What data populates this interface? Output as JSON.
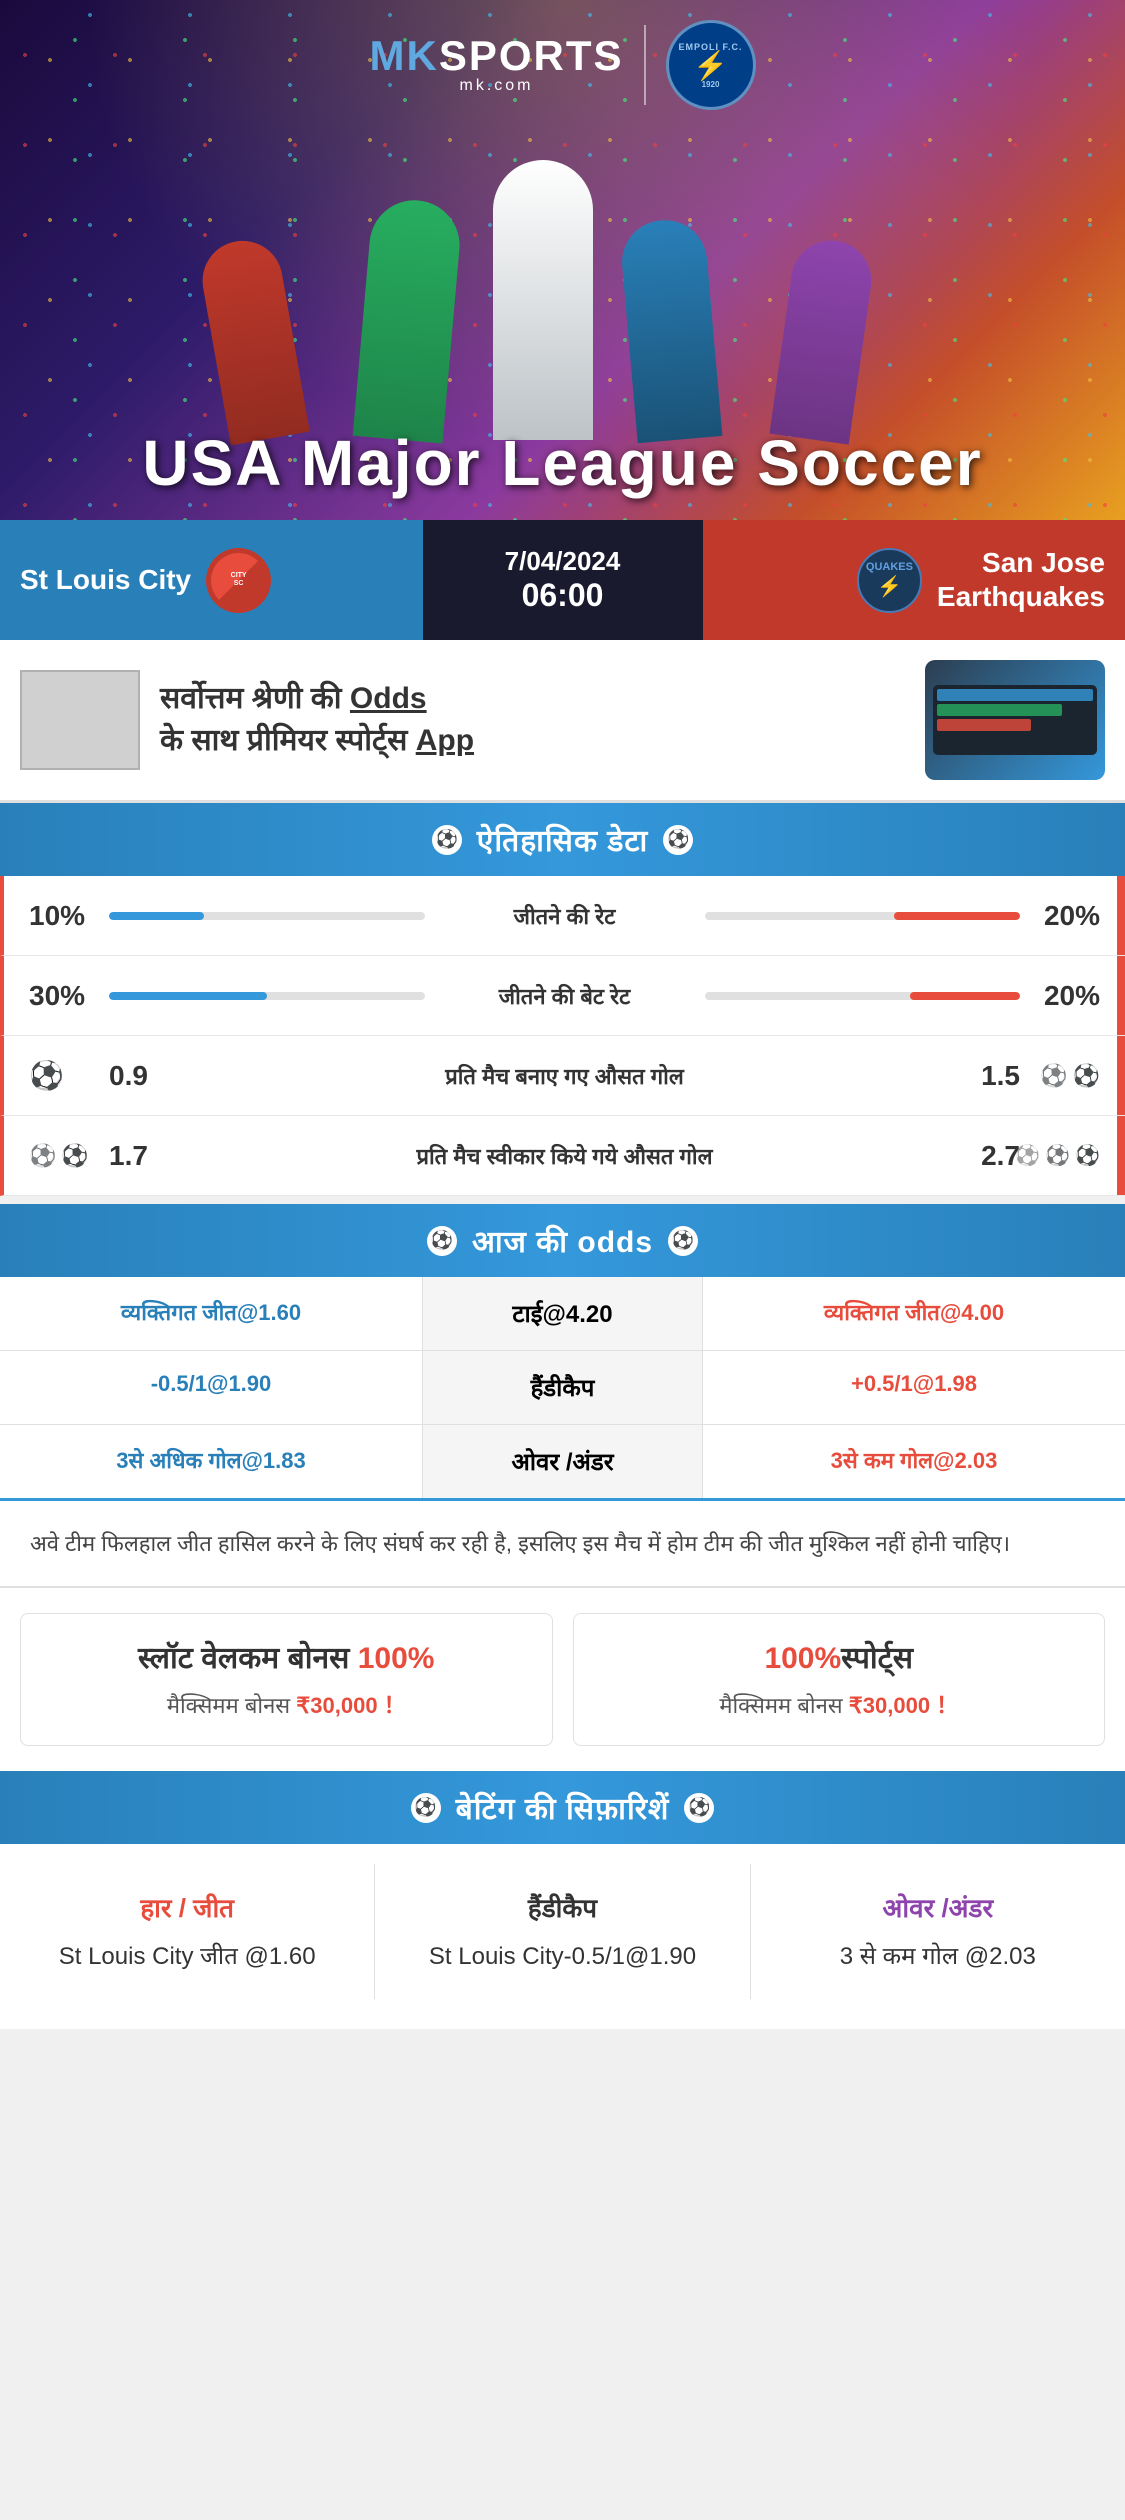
{
  "brand": {
    "name": "MK Sports",
    "mk_text": "MK",
    "sports_text": "SPORTS",
    "domain": "mk.com",
    "partner": "EMPOLI F.C.",
    "partner_year": "1920"
  },
  "hero": {
    "title": "USA Major League Soccer"
  },
  "match": {
    "home_team": "St Louis City",
    "away_team": "San Jose Earthquakes",
    "away_team_line1": "San Jose",
    "away_team_line2": "Earthquakes",
    "date": "7/04/2024",
    "time": "06:00",
    "home_badge": "CITY SC",
    "away_badge": "QUAKES"
  },
  "promo": {
    "text_line1": "सर्वोत्तम श्रेणी की",
    "odds_word": "Odds",
    "text_line2": "के साथ प्रीमियर स्पोर्ट्स",
    "app_word": "App"
  },
  "historical": {
    "section_title": "ऐतिहासिक डेटा",
    "rows": [
      {
        "label": "जीतने की रेट",
        "left_value": "10%",
        "right_value": "20%",
        "left_percent": 10,
        "right_percent": 20
      },
      {
        "label": "जीतने की बेट रेट",
        "left_value": "30%",
        "right_value": "20%",
        "left_percent": 30,
        "right_percent": 20
      },
      {
        "label": "प्रति मैच बनाए गए औसत गोल",
        "left_value": "0.9",
        "right_value": "1.5",
        "left_icons": 1,
        "right_icons": 2
      },
      {
        "label": "प्रति मैच स्वीकार किये गये औसत गोल",
        "left_value": "1.7",
        "right_value": "2.7",
        "left_icons": 2,
        "right_icons": 3
      }
    ]
  },
  "odds": {
    "section_title": "आज की odds",
    "rows": [
      {
        "left_label": "व्यक्तिगत जीत@1.60",
        "center_label": "टाई@4.20",
        "right_label": "व्यक्तिगत जीत@4.00",
        "left_color": "blue",
        "right_color": "red"
      },
      {
        "left_label": "-0.5/1@1.90",
        "center_label": "हैंडीकैप",
        "right_label": "+0.5/1@1.98",
        "left_color": "blue",
        "right_color": "red"
      },
      {
        "left_label": "3से अधिक गोल@1.83",
        "center_label": "ओवर /अंडर",
        "right_label": "3से कम गोल@2.03",
        "left_color": "blue",
        "right_color": "red"
      }
    ]
  },
  "description": {
    "text": "अवे टीम फिलहाल जीत हासिल करने के लिए संघर्ष कर रही है, इसलिए इस मैच में होम टीम की जीत मुश्किल नहीं होनी चाहिए।"
  },
  "bonuses": [
    {
      "title_main": "स्लॉट वेलकम बोनस",
      "percent": "100%",
      "subtitle": "मैक्सिमम बोनस ₹30,000 ！"
    },
    {
      "title_main": "100%स्पोर्ट्स",
      "percent": "",
      "subtitle": "मैक्सिमम बोनस  ₹30,000 ！"
    }
  ],
  "betting_recommendations": {
    "section_title": "बेटिंग की सिफ़ारिशें",
    "columns": [
      {
        "type_label": "हार / जीत",
        "recommendation": "St Louis City जीत @1.60",
        "color": "red"
      },
      {
        "type_label": "हैंडीकैप",
        "recommendation": "St Louis City-0.5/1@1.90",
        "color": "dark"
      },
      {
        "type_label": "ओवर /अंडर",
        "recommendation": "3 से कम गोल @2.03",
        "color": "purple"
      }
    ]
  }
}
